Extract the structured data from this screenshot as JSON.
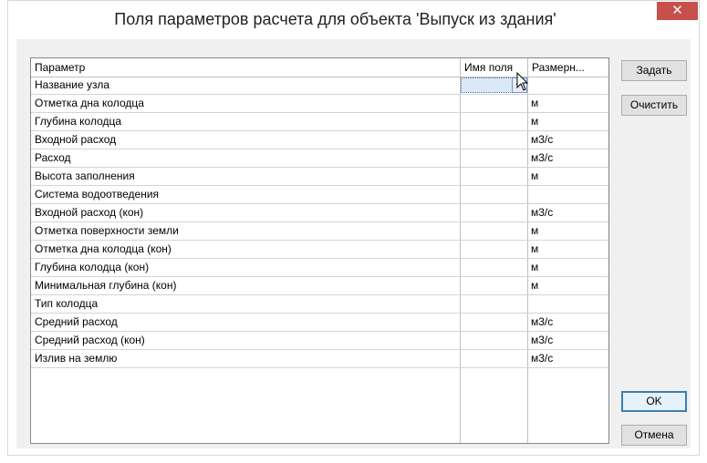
{
  "window": {
    "title": "Поля параметров расчета для объекта 'Выпуск из здания'",
    "close_glyph": "✕"
  },
  "table": {
    "columns": [
      "Параметр",
      "Имя поля",
      "Размерн..."
    ],
    "rows": [
      {
        "param": "Название узла",
        "field": "",
        "unit": ""
      },
      {
        "param": "Отметка дна колодца",
        "field": "",
        "unit": "м"
      },
      {
        "param": "Глубина колодца",
        "field": "",
        "unit": "м"
      },
      {
        "param": "Входной расход",
        "field": "",
        "unit": "м3/с"
      },
      {
        "param": "Расход",
        "field": "",
        "unit": "м3/с"
      },
      {
        "param": "Высота заполнения",
        "field": "",
        "unit": "м"
      },
      {
        "param": "Система водоотведения",
        "field": "",
        "unit": ""
      },
      {
        "param": "Входной расход (кон)",
        "field": "",
        "unit": "м3/с"
      },
      {
        "param": "Отметка поверхности земли",
        "field": "",
        "unit": "м"
      },
      {
        "param": "Отметка дна колодца (кон)",
        "field": "",
        "unit": "м"
      },
      {
        "param": "Глубина колодца (кон)",
        "field": "",
        "unit": "м"
      },
      {
        "param": "Минимальная глубина (кон)",
        "field": "",
        "unit": "м"
      },
      {
        "param": "Тип колодца",
        "field": "",
        "unit": ""
      },
      {
        "param": "Средний расход",
        "field": "",
        "unit": "м3/с"
      },
      {
        "param": "Средний расход (кон)",
        "field": "",
        "unit": "м3/с"
      },
      {
        "param": "Излив на землю",
        "field": "",
        "unit": "м3/с"
      }
    ],
    "edit_button_label": "..."
  },
  "buttons": {
    "set": "Задать",
    "clear": "Очистить",
    "ok": "OK",
    "cancel": "Отмена"
  },
  "colors": {
    "close": "#c7504a",
    "selection": "#dce8f6",
    "default_button_border": "#3c7fb1"
  }
}
